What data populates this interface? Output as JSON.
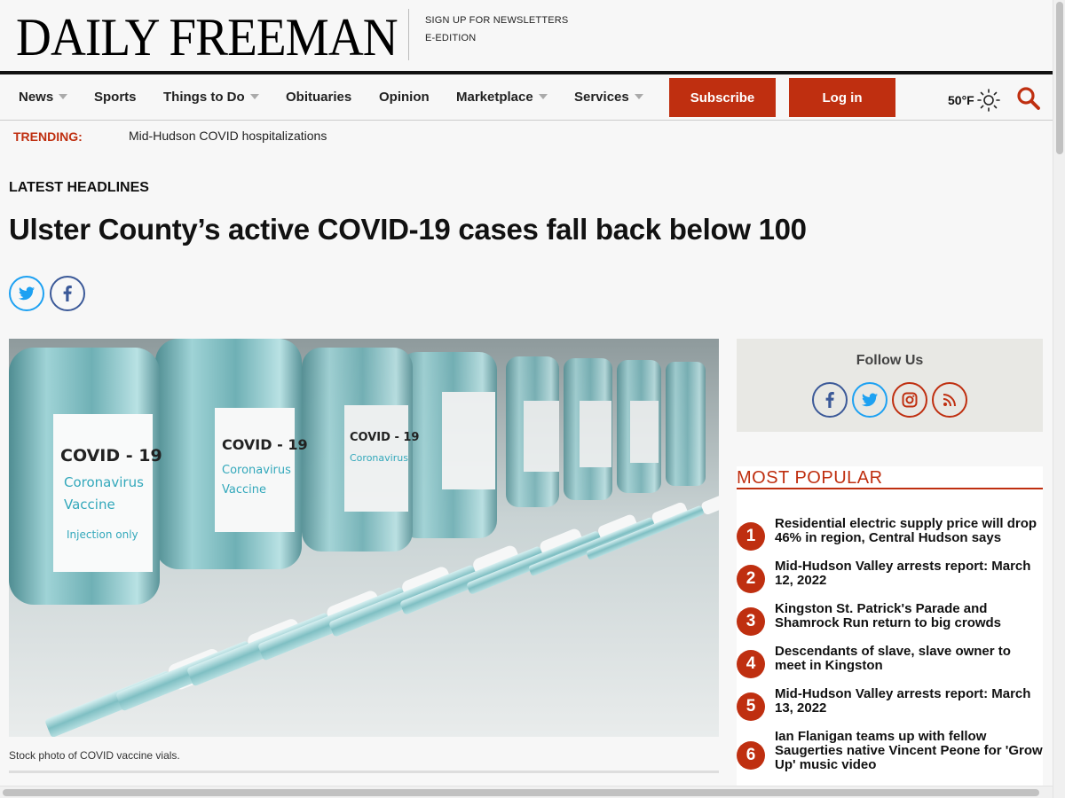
{
  "masthead": {
    "logo": "DAILY FREEMAN",
    "links": [
      "SIGN UP FOR NEWSLETTERS",
      "E-EDITION"
    ]
  },
  "nav": {
    "items": [
      {
        "label": "News",
        "dropdown": true
      },
      {
        "label": "Sports",
        "dropdown": false
      },
      {
        "label": "Things to Do",
        "dropdown": true
      },
      {
        "label": "Obituaries",
        "dropdown": false
      },
      {
        "label": "Opinion",
        "dropdown": false
      },
      {
        "label": "Marketplace",
        "dropdown": true
      },
      {
        "label": "Services",
        "dropdown": true
      }
    ],
    "subscribe": "Subscribe",
    "login": "Log in",
    "weather": "50°F",
    "weather_icon": "sun-icon",
    "search_icon": "search-icon"
  },
  "trending": {
    "label": "TRENDING:",
    "link": "Mid-Hudson COVID hospitalizations"
  },
  "article": {
    "section": "LATEST HEADLINES",
    "headline": "Ulster County’s active COVID-19 cases fall back below 100",
    "share": [
      "twitter-icon",
      "facebook-icon"
    ],
    "image": {
      "label_title": "COVID - 19",
      "label_lines": [
        "Coronavirus",
        "Vaccine",
        "Injection only"
      ]
    },
    "caption": "Stock photo of COVID vaccine vials."
  },
  "sidebar": {
    "follow_title": "Follow Us",
    "social": [
      "facebook-icon",
      "twitter-icon",
      "instagram-icon",
      "rss-icon"
    ],
    "popular_title": "MOST POPULAR",
    "popular": [
      {
        "num": "1",
        "title": "Residential electric supply price will drop 46% in region, Central Hudson says"
      },
      {
        "num": "2",
        "title": "Mid-Hudson Valley arrests report: March 12, 2022"
      },
      {
        "num": "3",
        "title": "Kingston St. Patrick's Parade and Shamrock Run return to big crowds"
      },
      {
        "num": "4",
        "title": "Descendants of slave, slave owner to meet in Kingston"
      },
      {
        "num": "5",
        "title": "Mid-Hudson Valley arrests report: March 13, 2022"
      },
      {
        "num": "6",
        "title": "Ian Flanigan teams up with fellow Saugerties native Vincent Peone for 'Grow Up' music video"
      }
    ]
  },
  "colors": {
    "accent": "#bf2f10",
    "twitter": "#1da1f2",
    "facebook": "#3b5998"
  }
}
